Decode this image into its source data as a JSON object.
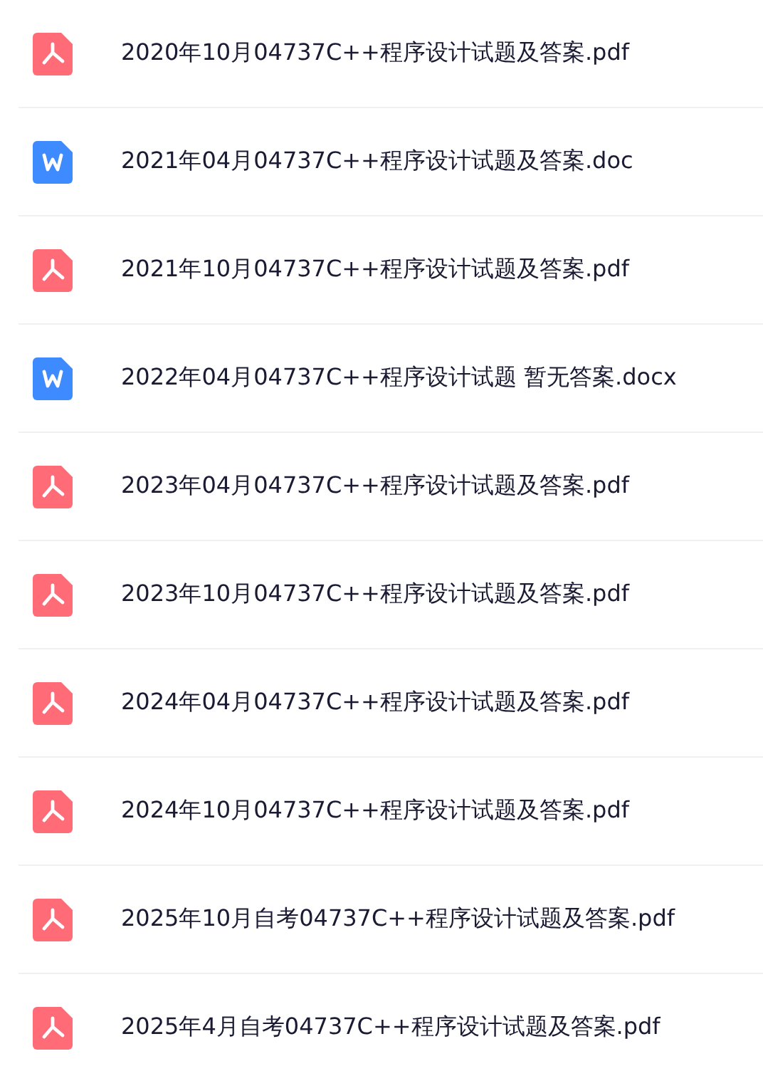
{
  "files": [
    {
      "kind": "pdf",
      "name": "2020年10月04737C++程序设计试题及答案.pdf"
    },
    {
      "kind": "word",
      "name": "2021年04月04737C++程序设计试题及答案.doc"
    },
    {
      "kind": "pdf",
      "name": "2021年10月04737C++程序设计试题及答案.pdf"
    },
    {
      "kind": "word",
      "name": "2022年04月04737C++程序设计试题 暂无答案.docx"
    },
    {
      "kind": "pdf",
      "name": "2023年04月04737C++程序设计试题及答案.pdf"
    },
    {
      "kind": "pdf",
      "name": "2023年10月04737C++程序设计试题及答案.pdf"
    },
    {
      "kind": "pdf",
      "name": "2024年04月04737C++程序设计试题及答案.pdf"
    },
    {
      "kind": "pdf",
      "name": "2024年10月04737C++程序设计试题及答案.pdf"
    },
    {
      "kind": "pdf",
      "name": "2025年10月自考04737C++程序设计试题及答案.pdf"
    },
    {
      "kind": "pdf",
      "name": "2025年4月自考04737C++程序设计试题及答案.pdf"
    }
  ]
}
